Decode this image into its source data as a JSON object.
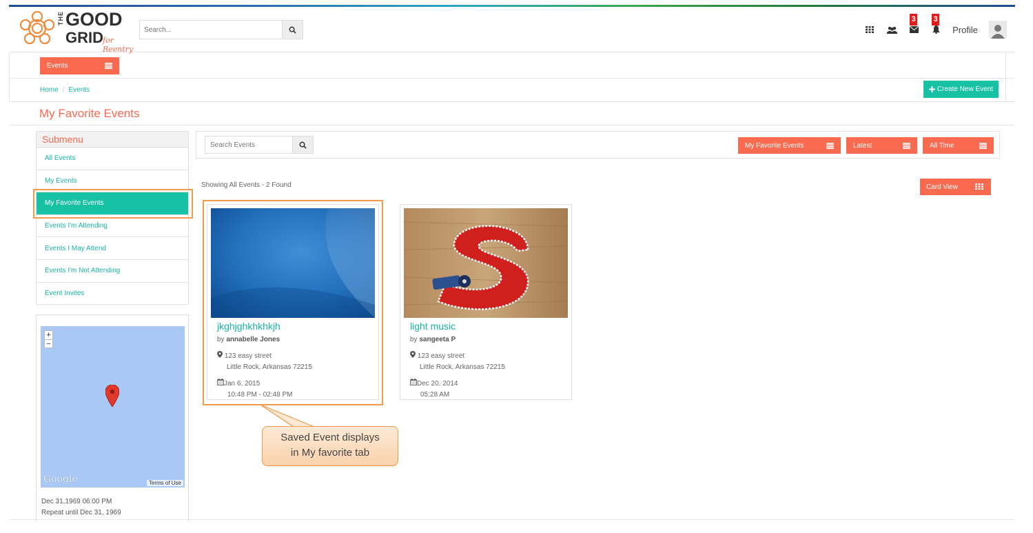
{
  "brand": {
    "logo_the": "THE",
    "logo_good": "GOOD",
    "logo_grid": "GRID",
    "logo_tagline": "for Reentry",
    "accent": "#fa6a4f",
    "teal": "#16c2a3"
  },
  "header": {
    "search_placeholder": "Search...",
    "icons": [
      "apps-grid-icon",
      "groups-icon",
      "mail-icon",
      "bell-icon"
    ],
    "mail_badge": "3",
    "bell_badge": "3",
    "profile_label": "Profile"
  },
  "nav": {
    "events_dropdown": "Events"
  },
  "breadcrumb": {
    "home": "Home",
    "separator": "/",
    "current": "Events"
  },
  "actions": {
    "create_event": "Create New Event"
  },
  "page": {
    "title": "My Favorite Events"
  },
  "submenu": {
    "heading": "Submenu",
    "items": [
      {
        "label": "All Events"
      },
      {
        "label": "My Events"
      },
      {
        "label": "My Favorite Events",
        "active": true
      },
      {
        "label": "Events I'm Attending"
      },
      {
        "label": "Events I May Attend"
      },
      {
        "label": "Events I'm Not Attending"
      },
      {
        "label": "Event Invites"
      }
    ]
  },
  "map": {
    "zoom_in": "+",
    "zoom_out": "−",
    "provider": "Google",
    "terms": "Terms of Use",
    "date": "Dec 31,1969 06:00 PM",
    "repeat": "Repeat until Dec 31, 1969"
  },
  "filters": {
    "search_placeholder": "Search Events",
    "favorite": "My Favorite Events",
    "sort": "Latest",
    "period": "All Time"
  },
  "results": {
    "summary": "Showing All Events - 2 Found",
    "view_toggle": "Card View"
  },
  "cards": [
    {
      "title": "jkghjghkhkhkjh",
      "by_prefix": "by",
      "author": "annabelle Jones",
      "address_line1": "123 easy street",
      "address_line2": "Little Rock, Arkansas 72215",
      "date": "Jan 6, 2015",
      "time": "10:48 PM - 02:48 PM"
    },
    {
      "title": "light music",
      "by_prefix": "by",
      "author": "sangeeta P",
      "address_line1": "123 easy street",
      "address_line2": "Little Rock, Arkansas 72215",
      "date": "Dec 20, 2014",
      "time": "05:28 AM"
    }
  ],
  "annotation": {
    "line1": "Saved Event displays",
    "line2": "in My favorite tab"
  }
}
